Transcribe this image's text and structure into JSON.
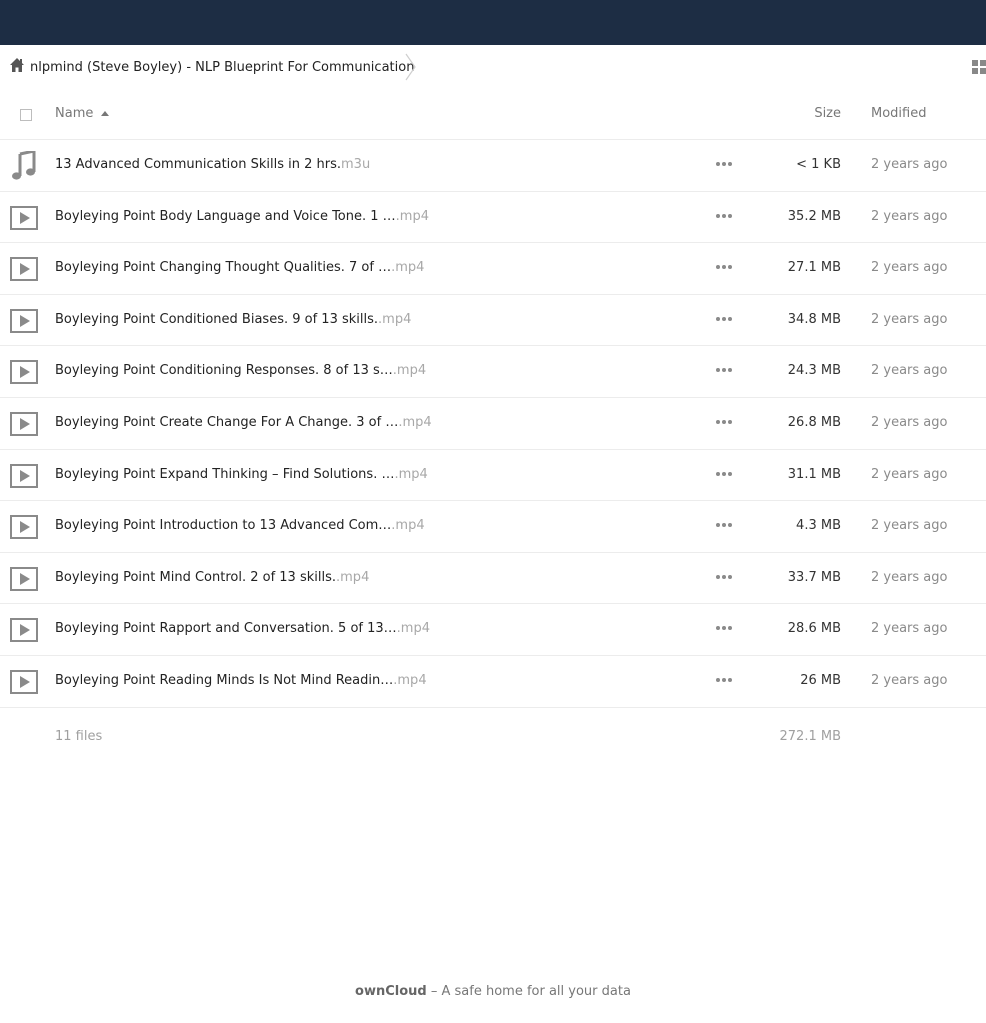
{
  "breadcrumb": {
    "home_icon": "home-icon",
    "folder": "nlpmind (Steve Boyley) - NLP Blueprint For Communication"
  },
  "columns": {
    "name": "Name",
    "size": "Size",
    "modified": "Modified"
  },
  "files": [
    {
      "icon": "music-note-icon",
      "name": "13 Advanced Communication Skills in 2 hrs.",
      "ext": "m3u",
      "size": "< 1 KB",
      "modified": "2 years ago"
    },
    {
      "icon": "video-play-icon",
      "name": "Boyleying Point Body Language and Voice Tone. 1 …",
      "ext": ".mp4",
      "size": "35.2 MB",
      "modified": "2 years ago"
    },
    {
      "icon": "video-play-icon",
      "name": "Boyleying Point Changing Thought Qualities. 7 of …",
      "ext": ".mp4",
      "size": "27.1 MB",
      "modified": "2 years ago"
    },
    {
      "icon": "video-play-icon",
      "name": "Boyleying Point Conditioned Biases. 9 of 13 skills.",
      "ext": ".mp4",
      "size": "34.8 MB",
      "modified": "2 years ago"
    },
    {
      "icon": "video-play-icon",
      "name": "Boyleying Point Conditioning Responses. 8 of 13 s…",
      "ext": ".mp4",
      "size": "24.3 MB",
      "modified": "2 years ago"
    },
    {
      "icon": "video-play-icon",
      "name": "Boyleying Point Create Change For A Change. 3 of …",
      "ext": ".mp4",
      "size": "26.8 MB",
      "modified": "2 years ago"
    },
    {
      "icon": "video-play-icon",
      "name": "Boyleying Point Expand Thinking – Find Solutions. …",
      "ext": ".mp4",
      "size": "31.1 MB",
      "modified": "2 years ago"
    },
    {
      "icon": "video-play-icon",
      "name": "Boyleying Point Introduction to 13 Advanced Com…",
      "ext": ".mp4",
      "size": "4.3 MB",
      "modified": "2 years ago"
    },
    {
      "icon": "video-play-icon",
      "name": "Boyleying Point Mind Control. 2 of 13 skills.",
      "ext": ".mp4",
      "size": "33.7 MB",
      "modified": "2 years ago"
    },
    {
      "icon": "video-play-icon",
      "name": "Boyleying Point Rapport and Conversation. 5 of 13…",
      "ext": ".mp4",
      "size": "28.6 MB",
      "modified": "2 years ago"
    },
    {
      "icon": "video-play-icon",
      "name": "Boyleying Point Reading Minds Is Not Mind Readin…",
      "ext": ".mp4",
      "size": "26 MB",
      "modified": "2 years ago"
    }
  ],
  "summary": {
    "count": "11 files",
    "total": "272.1 MB"
  },
  "footer": {
    "brand": "ownCloud",
    "tagline": " – A safe home for all your data"
  },
  "colors": {
    "topbar": "#1d2d44",
    "muted": "#a8a8a8",
    "icon": "#8a8a8a"
  }
}
